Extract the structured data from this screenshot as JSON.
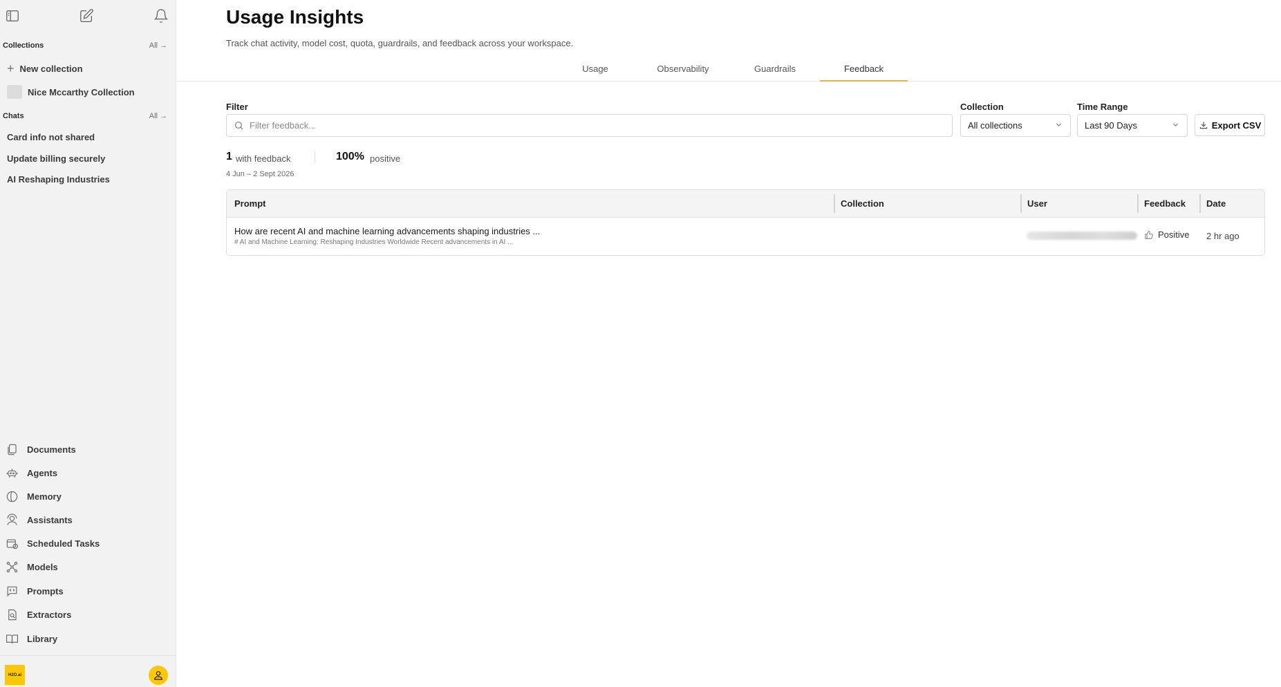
{
  "sidebar": {
    "collections_heading": "Collections",
    "collections_all": "All",
    "new_collection": "New collection",
    "collection_items": [
      "Nice Mccarthy Collection"
    ],
    "chats_heading": "Chats",
    "chats_all": "All",
    "chats": [
      "Card info not shared",
      "Update billing securely",
      "AI Reshaping Industries"
    ],
    "nav": [
      {
        "label": "Documents",
        "icon": "documents-icon"
      },
      {
        "label": "Agents",
        "icon": "agents-icon"
      },
      {
        "label": "Memory",
        "icon": "memory-icon"
      },
      {
        "label": "Assistants",
        "icon": "assistants-icon"
      },
      {
        "label": "Scheduled Tasks",
        "icon": "scheduled-tasks-icon"
      },
      {
        "label": "Models",
        "icon": "models-icon"
      },
      {
        "label": "Prompts",
        "icon": "prompts-icon"
      },
      {
        "label": "Extractors",
        "icon": "extractors-icon"
      },
      {
        "label": "Library",
        "icon": "library-icon"
      }
    ],
    "logo_text": "H2O.ai"
  },
  "page": {
    "title": "Usage Insights",
    "subtitle": "Track chat activity, model cost, quota, guardrails, and feedback across your workspace."
  },
  "tabs": [
    "Usage",
    "Observability",
    "Guardrails",
    "Feedback"
  ],
  "active_tab": "Feedback",
  "filters": {
    "filter_label": "Filter",
    "filter_placeholder": "Filter feedback...",
    "collection_label": "Collection",
    "collection_value": "All collections",
    "time_range_label": "Time Range",
    "time_range_value": "Last 90 Days",
    "export_label": "Export CSV"
  },
  "stats": {
    "count": "1",
    "count_label": "with feedback",
    "positive_pct": "100%",
    "positive_label": "positive",
    "date_range": "4 Jun – 2 Sept 2026"
  },
  "table": {
    "columns": [
      "Prompt",
      "Collection",
      "User",
      "Feedback",
      "Date"
    ],
    "rows": [
      {
        "prompt": "How are recent AI and machine learning advancements shaping industries ...",
        "response_preview": "# AI and Machine Learning: Reshaping Industries Worldwide Recent advancements in AI ...",
        "collection": "",
        "feedback": "Positive",
        "date": "2 hr ago"
      }
    ]
  },
  "colors": {
    "accent": "#e8b53e",
    "brand_yellow": "#fdc800",
    "sidebar_bg": "#f2f2f2"
  }
}
